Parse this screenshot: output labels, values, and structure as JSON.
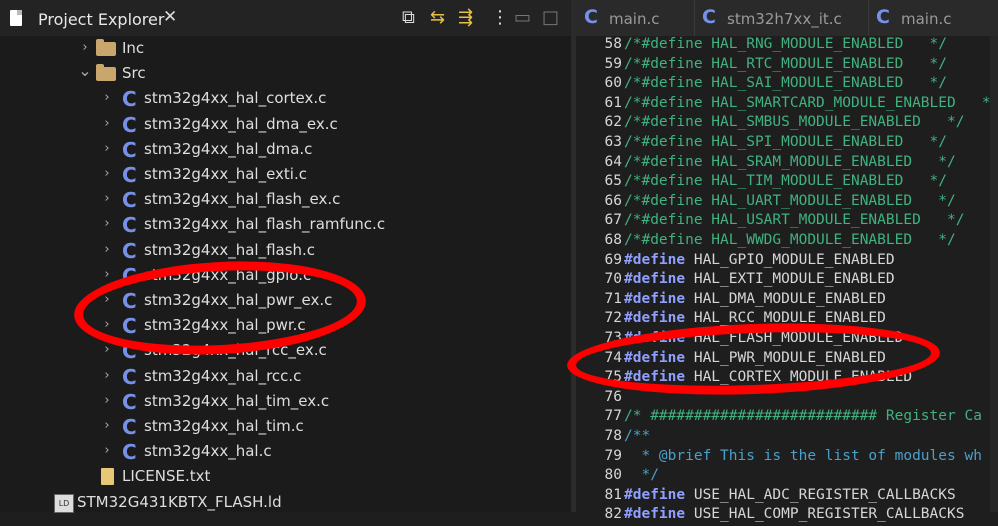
{
  "left_panel": {
    "title": "Project Explorer",
    "close_glyph": "✕",
    "tree": [
      {
        "label": "Inc",
        "type": "folder",
        "expanded": false
      },
      {
        "label": "Src",
        "type": "folder",
        "expanded": true
      },
      {
        "label": "stm32g4xx_hal_cortex.c",
        "type": "c-file"
      },
      {
        "label": "stm32g4xx_hal_dma_ex.c",
        "type": "c-file"
      },
      {
        "label": "stm32g4xx_hal_dma.c",
        "type": "c-file"
      },
      {
        "label": "stm32g4xx_hal_exti.c",
        "type": "c-file"
      },
      {
        "label": "stm32g4xx_hal_flash_ex.c",
        "type": "c-file"
      },
      {
        "label": "stm32g4xx_hal_flash_ramfunc.c",
        "type": "c-file"
      },
      {
        "label": "stm32g4xx_hal_flash.c",
        "type": "c-file"
      },
      {
        "label": "stm32g4xx_hal_gpio.c",
        "type": "c-file"
      },
      {
        "label": "stm32g4xx_hal_pwr_ex.c",
        "type": "c-file"
      },
      {
        "label": "stm32g4xx_hal_pwr.c",
        "type": "c-file"
      },
      {
        "label": "stm32g4xx_hal_rcc_ex.c",
        "type": "c-file"
      },
      {
        "label": "stm32g4xx_hal_rcc.c",
        "type": "c-file"
      },
      {
        "label": "stm32g4xx_hal_tim_ex.c",
        "type": "c-file"
      },
      {
        "label": "stm32g4xx_hal_tim.c",
        "type": "c-file"
      },
      {
        "label": "stm32g4xx_hal.c",
        "type": "c-file"
      },
      {
        "label": "LICENSE.txt",
        "type": "txt-file"
      },
      {
        "label": "STM32G431KBTX_FLASH.ld",
        "type": "ld-file"
      }
    ]
  },
  "editor": {
    "tabs": [
      {
        "label": "main.c",
        "icon": "c-file-icon"
      },
      {
        "label": "stm32h7xx_it.c",
        "icon": "c-file-icon"
      },
      {
        "label": "main.c",
        "icon": "c-file-icon"
      }
    ],
    "lines": [
      {
        "n": "58",
        "parts": [
          [
            "cm",
            "/*#define HAL_RNG_MODULE_ENABLED   */"
          ]
        ]
      },
      {
        "n": "59",
        "parts": [
          [
            "cm",
            "/*#define HAL_RTC_MODULE_ENABLED   */"
          ]
        ]
      },
      {
        "n": "60",
        "parts": [
          [
            "cm",
            "/*#define HAL_SAI_MODULE_ENABLED   */"
          ]
        ]
      },
      {
        "n": "61",
        "parts": [
          [
            "cm",
            "/*#define HAL_SMARTCARD_MODULE_ENABLED   */"
          ]
        ]
      },
      {
        "n": "62",
        "parts": [
          [
            "cm",
            "/*#define HAL_SMBUS_MODULE_ENABLED   */"
          ]
        ]
      },
      {
        "n": "63",
        "parts": [
          [
            "cm",
            "/*#define HAL_SPI_MODULE_ENABLED   */"
          ]
        ]
      },
      {
        "n": "64",
        "parts": [
          [
            "cm",
            "/*#define HAL_SRAM_MODULE_ENABLED   */"
          ]
        ]
      },
      {
        "n": "65",
        "parts": [
          [
            "cm",
            "/*#define HAL_TIM_MODULE_ENABLED   */"
          ]
        ]
      },
      {
        "n": "66",
        "parts": [
          [
            "cm",
            "/*#define HAL_UART_MODULE_ENABLED   */"
          ]
        ]
      },
      {
        "n": "67",
        "parts": [
          [
            "cm",
            "/*#define HAL_USART_MODULE_ENABLED   */"
          ]
        ]
      },
      {
        "n": "68",
        "parts": [
          [
            "cm",
            "/*#define HAL_WWDG_MODULE_ENABLED   */"
          ]
        ]
      },
      {
        "n": "69",
        "parts": [
          [
            "kw",
            "#define"
          ],
          [
            "mac",
            " HAL_GPIO_MODULE_ENABLED"
          ]
        ]
      },
      {
        "n": "70",
        "parts": [
          [
            "kw",
            "#define"
          ],
          [
            "mac",
            " HAL_EXTI_MODULE_ENABLED"
          ]
        ]
      },
      {
        "n": "71",
        "parts": [
          [
            "kw",
            "#define"
          ],
          [
            "mac",
            " HAL_DMA_MODULE_ENABLED"
          ]
        ]
      },
      {
        "n": "72",
        "parts": [
          [
            "kw",
            "#define"
          ],
          [
            "mac",
            " HAL_RCC_MODULE_ENABLED"
          ]
        ]
      },
      {
        "n": "73",
        "parts": [
          [
            "kw",
            "#define"
          ],
          [
            "mac",
            " HAL_FLASH_MODULE_ENABLED"
          ]
        ]
      },
      {
        "n": "74",
        "parts": [
          [
            "kw",
            "#define"
          ],
          [
            "mac",
            " HAL_PWR_MODULE_ENABLED"
          ]
        ]
      },
      {
        "n": "75",
        "parts": [
          [
            "kw",
            "#define"
          ],
          [
            "mac",
            " HAL_CORTEX_MODULE_ENABLED"
          ]
        ]
      },
      {
        "n": "76",
        "parts": []
      },
      {
        "n": "77",
        "parts": [
          [
            "cm",
            "/* ########################## Register Ca"
          ]
        ]
      },
      {
        "n": "78",
        "parts": [
          [
            "dc",
            "/**"
          ]
        ]
      },
      {
        "n": "79",
        "parts": [
          [
            "dc",
            "  * @brief This is the list of modules wh"
          ]
        ]
      },
      {
        "n": "80",
        "parts": [
          [
            "dc",
            "  */"
          ]
        ]
      },
      {
        "n": "81",
        "parts": [
          [
            "kw",
            "#define"
          ],
          [
            "mac",
            " USE_HAL_ADC_REGISTER_CALLBACKS"
          ]
        ]
      },
      {
        "n": "82",
        "parts": [
          [
            "kw",
            "#define"
          ],
          [
            "mac",
            " USE_HAL_COMP_REGISTER_CALLBACKS"
          ]
        ]
      }
    ]
  },
  "annotation_color": "#ff0000"
}
